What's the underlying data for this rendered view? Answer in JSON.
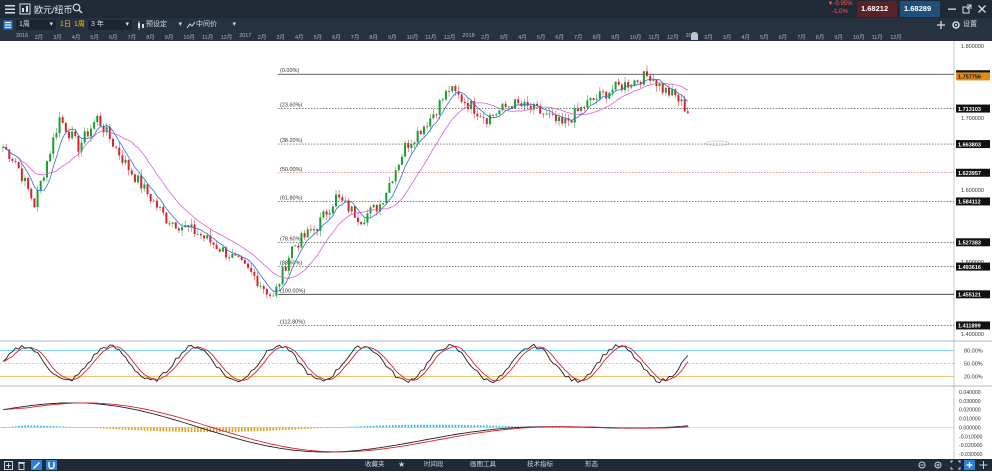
{
  "header": {
    "title": "欧元/纽币",
    "change_pct": "▼-0.95%",
    "change_abs": "-1.0%",
    "sell_price": "1.68212",
    "buy_price": "1.68289",
    "settings_label": "设置"
  },
  "toolbar": {
    "interval": "1周",
    "range_1d": "1日",
    "range_1w": "1周",
    "range_3y": "3 年",
    "preset": "预设定",
    "mid_price": "中间价"
  },
  "time_axis": [
    "2016",
    "2月",
    "3月",
    "4月",
    "5月",
    "6月",
    "7月",
    "8月",
    "9月",
    "10月",
    "11月",
    "12月",
    "2017",
    "2月",
    "3月",
    "4月",
    "5月",
    "6月",
    "7月",
    "8月",
    "9月",
    "10月",
    "11月",
    "12月",
    "2018",
    "2月",
    "3月",
    "4月",
    "5月",
    "6月",
    "7月",
    "8月",
    "9月",
    "10月",
    "11月",
    "12月",
    "2019",
    "2月",
    "3月",
    "4月",
    "5月",
    "6月",
    "7月",
    "8月",
    "9月",
    "10月",
    "11月",
    "12月"
  ],
  "fib_levels": [
    {
      "label": "(0.00%)",
      "price": "1.760780",
      "value": 1.76078
    },
    {
      "label": "(23.60%)",
      "price": "1.713103",
      "value": 1.713103
    },
    {
      "label": "(38.20%)",
      "price": "1.663803",
      "value": 1.663803
    },
    {
      "label": "(50.00%)",
      "price": "1.623957",
      "value": 1.623957
    },
    {
      "label": "(61.80%)",
      "price": "1.584112",
      "value": 1.584112
    },
    {
      "label": "(78.60%)",
      "price": "1.527383",
      "value": 1.527383
    },
    {
      "label": "(88.60%)",
      "price": "1.493616",
      "value": 1.493616
    },
    {
      "label": "(100.00%)",
      "price": "1.455121",
      "value": 1.455121
    },
    {
      "label": "(112.80%)",
      "price": "1.411899",
      "value": 1.411899
    }
  ],
  "price_axis": [
    "1.800000",
    "1.700000",
    "1.600000",
    "1.500000",
    "1.400000"
  ],
  "price_axis_values": [
    1.8,
    1.7,
    1.6,
    1.5,
    1.4
  ],
  "current_price_label": "1.757756",
  "current_price_value": 1.757756,
  "stoch_axis": [
    "80.00%",
    "50.00%",
    "20.00%"
  ],
  "macd_axis": [
    "0.040000",
    "0.030000",
    "0.020000",
    "0.010000",
    "0.000000",
    "-0.010000",
    "-0.020000",
    "-0.030000"
  ],
  "bottom_bar": {
    "favorites": "收藏夹",
    "timeframe": "时间段",
    "drawing_tools": "画图工具",
    "indicators": "技术指标",
    "shapes": "形态"
  },
  "colors": {
    "up": "#1a9e2e",
    "down": "#d9232d",
    "ma_fast": "#2f6fd6",
    "ma_slow": "#e05fd0",
    "header_bg": "#1f2a36",
    "sell_bg": "#8a2a2a",
    "buy_bg": "#1f4f7a",
    "current_price_bg": "#e08a1a"
  }
}
